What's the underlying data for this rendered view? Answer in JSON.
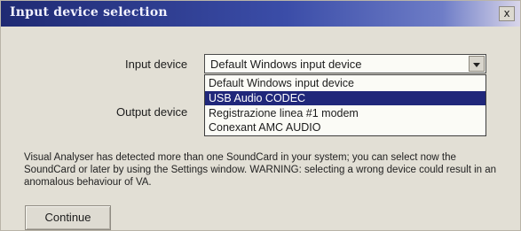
{
  "window": {
    "title": "Input device selection",
    "close_label": "x"
  },
  "form": {
    "input_label": "Input device",
    "output_label": "Output device",
    "input_selected": "Default Windows input device",
    "input_options": [
      "Default Windows input device",
      "USB Audio CODEC",
      "Registrazione linea #1 modem",
      "Conexant AMC AUDIO"
    ]
  },
  "message": "Visual Analyser has detected more than one SoundCard in your system; you can select now the SoundCard or later by using the Settings window. WARNING: selecting a wrong device could result in an anomalous behaviour of VA.",
  "buttons": {
    "continue_label": "Continue"
  },
  "colors": {
    "title_bar": "#1f2a73",
    "selection_highlight": "#20277a"
  },
  "icons": {
    "close": "close-icon",
    "dropdown": "chevron-down-icon"
  }
}
